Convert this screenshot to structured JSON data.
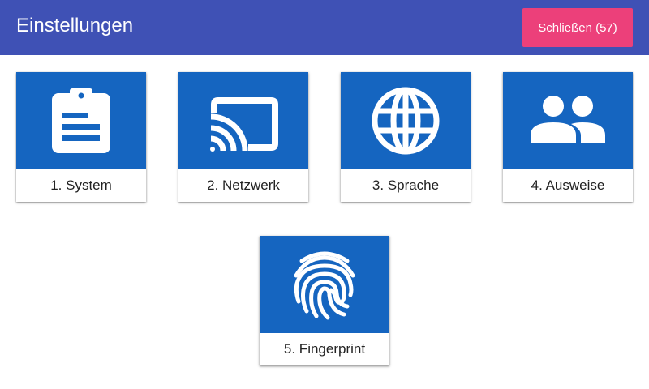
{
  "header": {
    "title": "Einstellungen",
    "close_label": "Schließen (57)"
  },
  "colors": {
    "header_bg": "#3f51b5",
    "close_button_bg": "#ec407a",
    "tile_bg": "#1565c0"
  },
  "tiles": [
    {
      "label": "1. System",
      "icon": "clipboard-icon"
    },
    {
      "label": "2. Netzwerk",
      "icon": "cast-icon"
    },
    {
      "label": "3. Sprache",
      "icon": "globe-icon"
    },
    {
      "label": "4. Ausweise",
      "icon": "people-icon"
    },
    {
      "label": "5. Fingerprint",
      "icon": "fingerprint-icon"
    }
  ]
}
